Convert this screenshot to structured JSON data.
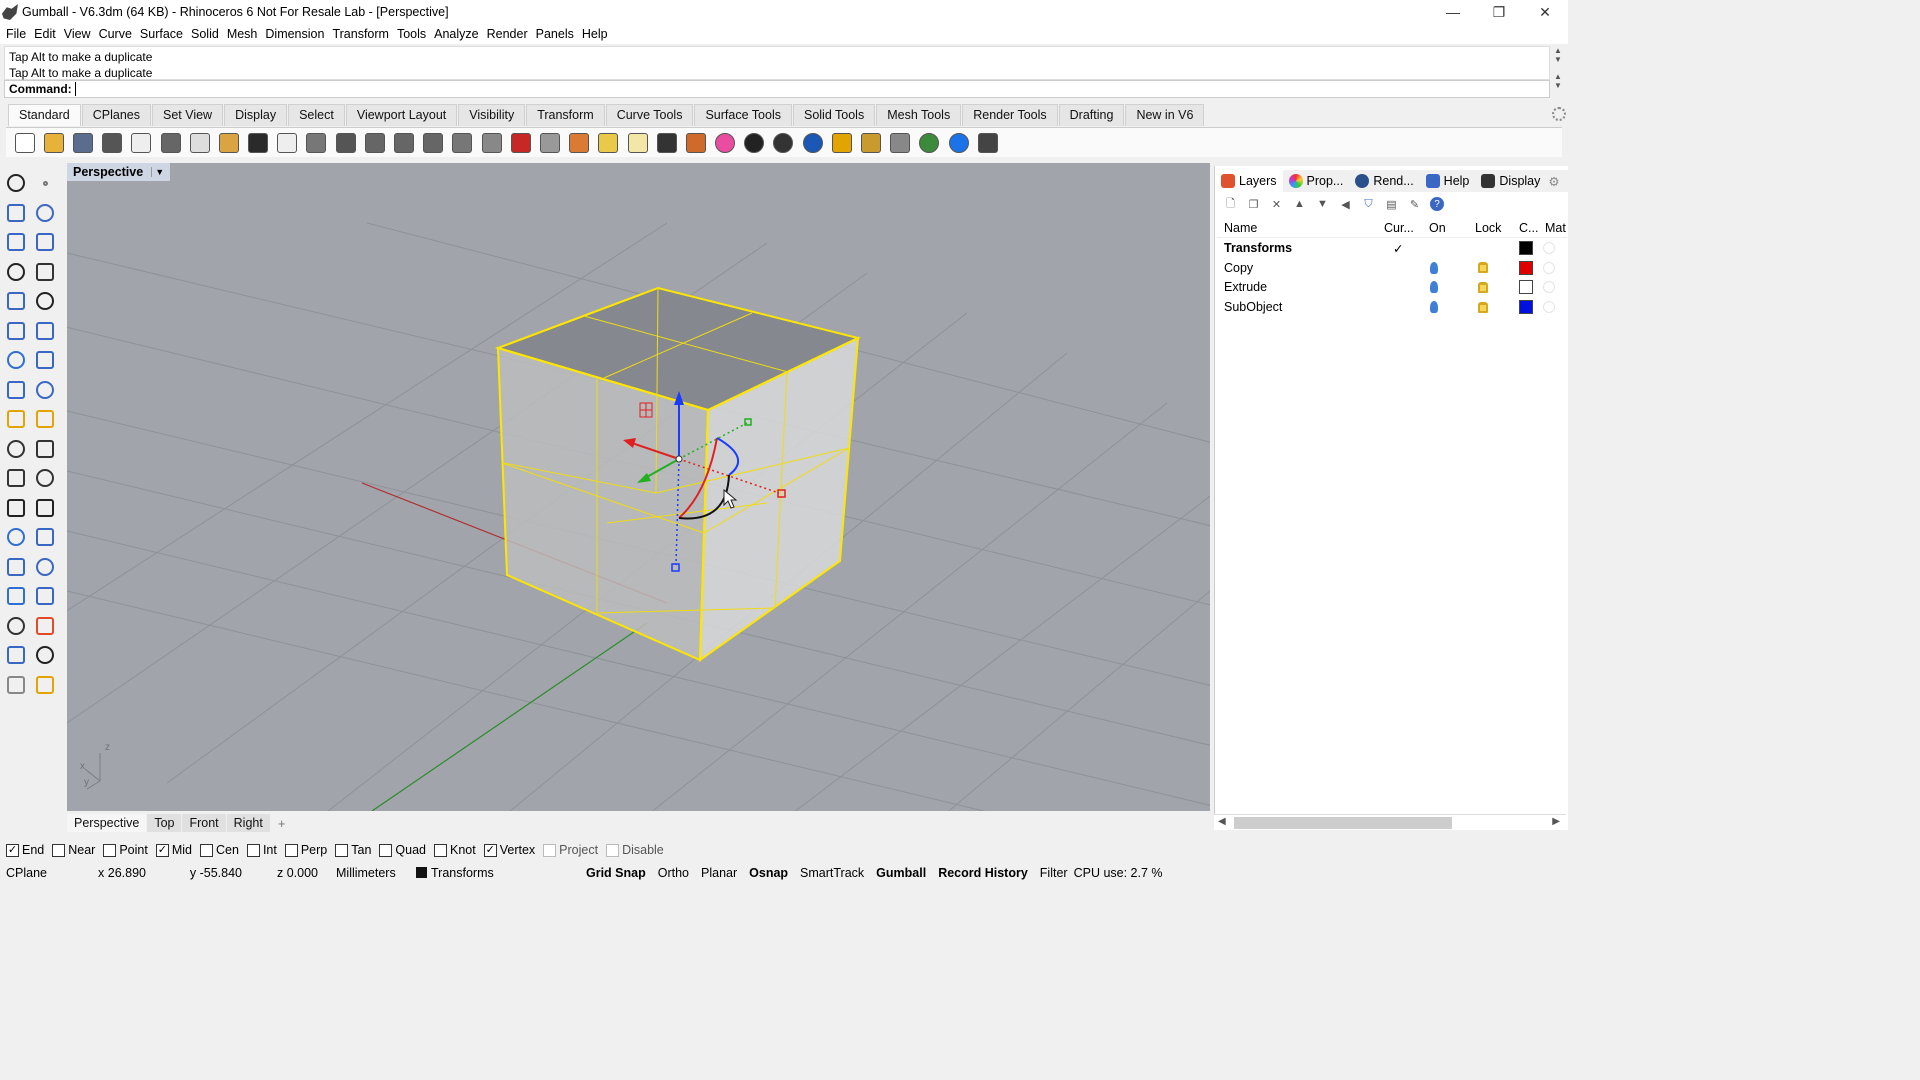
{
  "window": {
    "title": "Gumball - V6.3dm (64 KB) - Rhinoceros 6 Not For Resale Lab - [Perspective]",
    "minimize": "—",
    "maximize": "❐",
    "close": "✕"
  },
  "menu": [
    "File",
    "Edit",
    "View",
    "Curve",
    "Surface",
    "Solid",
    "Mesh",
    "Dimension",
    "Transform",
    "Tools",
    "Analyze",
    "Render",
    "Panels",
    "Help"
  ],
  "command": {
    "history": [
      "Tap Alt to make a duplicate",
      "Tap Alt to make a duplicate"
    ],
    "prompt": "Command:",
    "value": ""
  },
  "toolbar_tabs": [
    "Standard",
    "CPlanes",
    "Set View",
    "Display",
    "Select",
    "Viewport Layout",
    "Visibility",
    "Transform",
    "Curve Tools",
    "Surface Tools",
    "Solid Tools",
    "Mesh Tools",
    "Render Tools",
    "Drafting",
    "New in V6"
  ],
  "active_toolbar_tab": "Standard",
  "toolbar_icons": [
    "new-icon",
    "open-icon",
    "save-icon",
    "print-icon",
    "export-icon",
    "cut-icon",
    "copy-icon",
    "paste-icon",
    "undo-icon",
    "pan-hand-icon",
    "rotate-view-icon",
    "zoom-in-icon",
    "zoom-window-icon",
    "zoom-extents-icon",
    "zoom-selected-icon",
    "zoom-dynamic-icon",
    "four-views-icon",
    "car-icon",
    "plane-icon",
    "cplane-icon",
    "named-views-icon",
    "light-bulb-icon",
    "lock-icon",
    "box-render-icon",
    "color-wheel-icon",
    "sphere-shade-icon",
    "sphere-rendered-icon",
    "sphere-blue-icon",
    "brush-icon",
    "gear-options-icon",
    "dimension-icon",
    "globe-icon",
    "help-icon",
    "tool-icon"
  ],
  "toolbar_icon_colors": [
    "#fff",
    "#e7b23a",
    "#5a6d8e",
    "#555",
    "#eee",
    "#666",
    "#ddd",
    "#d9a441",
    "#2a2a2a",
    "#eee",
    "#777",
    "#555",
    "#666",
    "#666",
    "#666",
    "#777",
    "#888",
    "#c62828",
    "#999",
    "#d97a35",
    "#e8c94a",
    "#f2e7a6",
    "#333",
    "#d06a2a",
    "#e94ca0",
    "#222",
    "#333",
    "#1b57b5",
    "#e2a400",
    "#c99b2f",
    "#888",
    "#3c8a3c",
    "#1a73e8",
    "#444"
  ],
  "left_tool_icons": [
    "select-arrow-icon",
    "point-icon",
    "polyline-icon",
    "curve-icon",
    "circle-icon",
    "ellipse-icon",
    "arc-icon",
    "rectangle-icon",
    "polygon-icon",
    "fillet-curve-icon",
    "surface-from-points-icon",
    "revolve-icon",
    "box-solid-icon",
    "boolean-icon",
    "cylinder-icon",
    "extrude-icon",
    "gear-mesh-icon",
    "analyze-icon",
    "split-icon",
    "trim-icon",
    "group-icon",
    "point-group-icon",
    "curve-on-surface-icon",
    "offset-icon",
    "text-icon",
    "scale-icon",
    "block-icon",
    "edit-block-icon",
    "drape-icon",
    "dimension-left-icon",
    "array-icon",
    "gumball-icon",
    "clip-icon",
    "check-icon",
    "material-icon",
    "render-left-icon"
  ],
  "viewport": {
    "name": "Perspective",
    "tabs": [
      "Perspective",
      "Top",
      "Front",
      "Right"
    ],
    "active_tab": "Perspective",
    "add_tab": "+",
    "axis_labels": {
      "z": "z",
      "x": "x",
      "y": "y"
    }
  },
  "panel": {
    "tabs": [
      {
        "label": "Layers",
        "icon": "layers-icon"
      },
      {
        "label": "Prop...",
        "icon": "properties-icon"
      },
      {
        "label": "Rend...",
        "icon": "rendering-icon"
      },
      {
        "label": "Help",
        "icon": "help-panel-icon"
      },
      {
        "label": "Display",
        "icon": "display-icon"
      }
    ],
    "active_tab": "Layers",
    "toolbar": [
      "new-layer-icon",
      "new-sublayer-icon",
      "delete-icon",
      "move-up-icon",
      "move-down-icon",
      "move-to-parent-icon",
      "filter-icon",
      "layer-states-icon",
      "tools-icon",
      "help-icon"
    ],
    "columns": {
      "name": "Name",
      "current": "Cur...",
      "on": "On",
      "lock": "Lock",
      "color": "C...",
      "material": "Mat"
    },
    "layers": [
      {
        "name": "Transforms",
        "current": "✓",
        "on": false,
        "lock": false,
        "color": "#000000",
        "bold": true
      },
      {
        "name": "Copy",
        "current": "",
        "on": true,
        "lock": true,
        "color": "#e00000",
        "bold": false
      },
      {
        "name": "Extrude",
        "current": "",
        "on": true,
        "lock": true,
        "color": "#ffffff",
        "bold": false
      },
      {
        "name": "SubObject",
        "current": "",
        "on": true,
        "lock": true,
        "color": "#0010e0",
        "bold": false
      }
    ]
  },
  "osnaps": [
    {
      "label": "End",
      "checked": true
    },
    {
      "label": "Near",
      "checked": false
    },
    {
      "label": "Point",
      "checked": false
    },
    {
      "label": "Mid",
      "checked": true
    },
    {
      "label": "Cen",
      "checked": false
    },
    {
      "label": "Int",
      "checked": false
    },
    {
      "label": "Perp",
      "checked": false
    },
    {
      "label": "Tan",
      "checked": false
    },
    {
      "label": "Quad",
      "checked": false
    },
    {
      "label": "Knot",
      "checked": false
    },
    {
      "label": "Vertex",
      "checked": true
    },
    {
      "label": "Project",
      "checked": false,
      "disabled": true
    },
    {
      "label": "Disable",
      "checked": false,
      "disabled": true
    }
  ],
  "status": {
    "cplane": "CPlane",
    "x": "x 26.890",
    "y": "y -55.840",
    "z": "z 0.000",
    "units": "Millimeters",
    "layer": "Transforms",
    "grid_snap": "Grid Snap",
    "ortho": "Ortho",
    "planar": "Planar",
    "osnap": "Osnap",
    "smarttrack": "SmartTrack",
    "gumball": "Gumball",
    "record_history": "Record History",
    "filter": "Filter",
    "cpu": "CPU use: 2.7 %"
  }
}
